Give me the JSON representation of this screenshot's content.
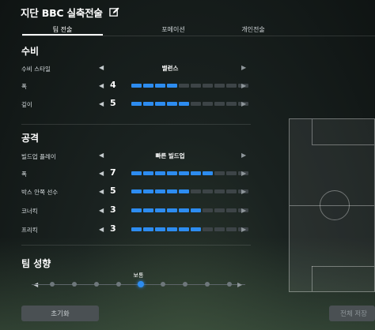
{
  "header": {
    "title": "지단 BBC 실축전술",
    "edit_icon": "pencil-edit-icon"
  },
  "tabs": [
    {
      "label": "팀 전술",
      "active": true
    },
    {
      "label": "포메이션",
      "active": false
    },
    {
      "label": "개인전술",
      "active": false
    }
  ],
  "defense": {
    "title": "수비",
    "style_label": "수비 스타일",
    "style_value": "밸런스",
    "rows": [
      {
        "label": "폭",
        "value": "4",
        "level": 4,
        "max": 10
      },
      {
        "label": "깊이",
        "value": "5",
        "level": 5,
        "max": 10
      }
    ]
  },
  "attack": {
    "title": "공격",
    "style_label": "빌드업 플레이",
    "style_value": "빠른 빌드업",
    "rows": [
      {
        "label": "폭",
        "value": "7",
        "level": 7,
        "max": 10
      },
      {
        "label": "박스 안쪽 선수",
        "value": "5",
        "level": 5,
        "max": 10
      },
      {
        "label": "코너킥",
        "value": "3",
        "level": 3,
        "max": 5
      },
      {
        "label": "프리킥",
        "value": "3",
        "level": 3,
        "max": 5
      }
    ]
  },
  "team_tendency": {
    "title": "팀 성향",
    "current_label": "보통",
    "positions": 9,
    "current_index": 5
  },
  "buttons": {
    "reset": "초기화",
    "save_all": "전체 저장"
  },
  "colors": {
    "accent": "#2d8cf0",
    "track": "#3d4447"
  }
}
